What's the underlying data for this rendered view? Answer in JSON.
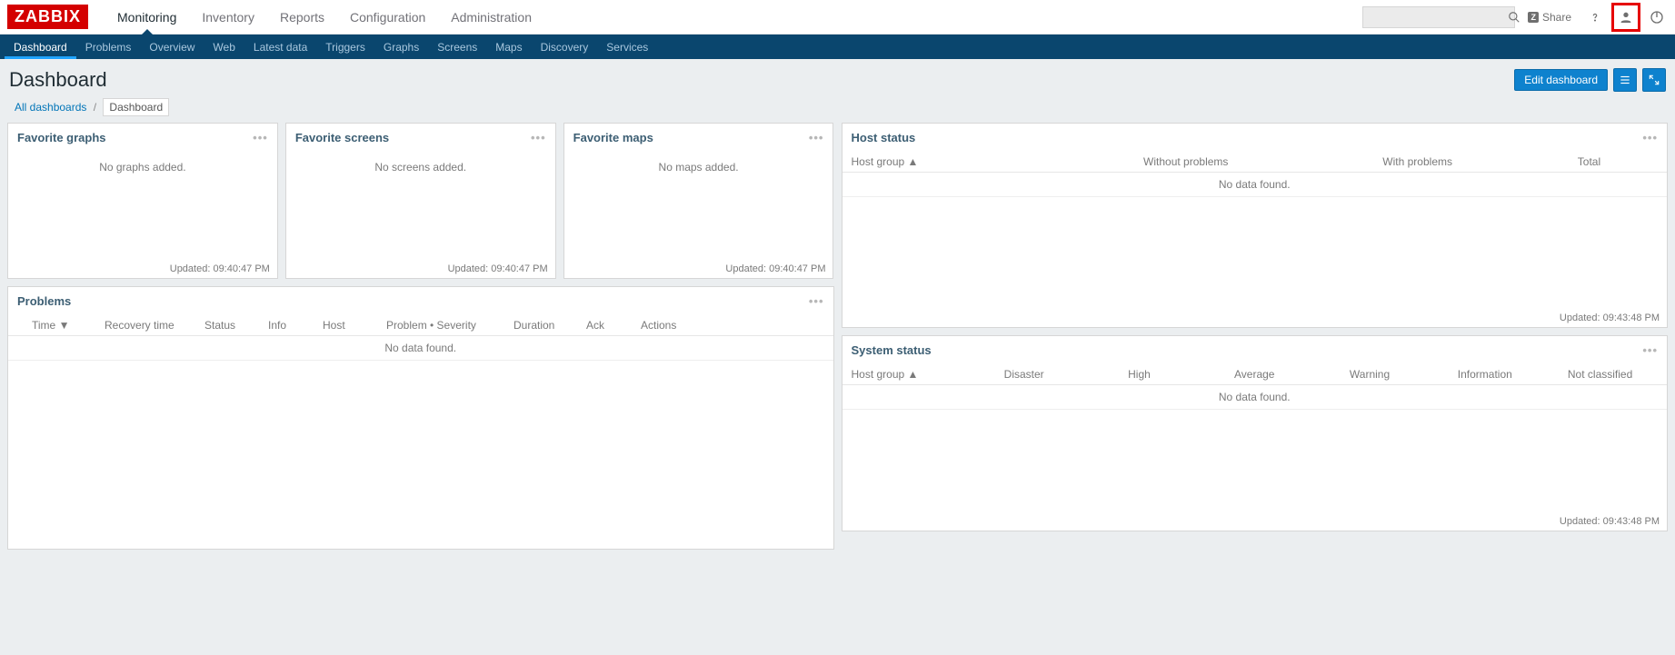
{
  "brand": "ZABBIX",
  "topnav": [
    {
      "label": "Monitoring",
      "active": true
    },
    {
      "label": "Inventory"
    },
    {
      "label": "Reports"
    },
    {
      "label": "Configuration"
    },
    {
      "label": "Administration"
    }
  ],
  "share_label": "Share",
  "subnav": [
    {
      "label": "Dashboard",
      "active": true
    },
    {
      "label": "Problems"
    },
    {
      "label": "Overview"
    },
    {
      "label": "Web"
    },
    {
      "label": "Latest data"
    },
    {
      "label": "Triggers"
    },
    {
      "label": "Graphs"
    },
    {
      "label": "Screens"
    },
    {
      "label": "Maps"
    },
    {
      "label": "Discovery"
    },
    {
      "label": "Services"
    }
  ],
  "page_title": "Dashboard",
  "edit_button": "Edit dashboard",
  "breadcrumb": {
    "root": "All dashboards",
    "current": "Dashboard"
  },
  "widgets": {
    "fav_graphs": {
      "title": "Favorite graphs",
      "empty": "No graphs added.",
      "updated": "Updated: 09:40:47 PM"
    },
    "fav_screens": {
      "title": "Favorite screens",
      "empty": "No screens added.",
      "updated": "Updated: 09:40:47 PM"
    },
    "fav_maps": {
      "title": "Favorite maps",
      "empty": "No maps added.",
      "updated": "Updated: 09:40:47 PM"
    },
    "problems": {
      "title": "Problems",
      "cols": {
        "time": "Time",
        "recovery": "Recovery time",
        "status": "Status",
        "info": "Info",
        "host": "Host",
        "problem": "Problem • Severity",
        "duration": "Duration",
        "ack": "Ack",
        "actions": "Actions"
      },
      "nodata": "No data found."
    },
    "host_status": {
      "title": "Host status",
      "cols": {
        "group": "Host group",
        "without": "Without problems",
        "with": "With problems",
        "total": "Total"
      },
      "nodata": "No data found.",
      "updated": "Updated: 09:43:48 PM"
    },
    "system_status": {
      "title": "System status",
      "cols": {
        "group": "Host group",
        "disaster": "Disaster",
        "high": "High",
        "average": "Average",
        "warning": "Warning",
        "information": "Information",
        "not_classified": "Not classified"
      },
      "nodata": "No data found.",
      "updated": "Updated: 09:43:48 PM"
    }
  }
}
